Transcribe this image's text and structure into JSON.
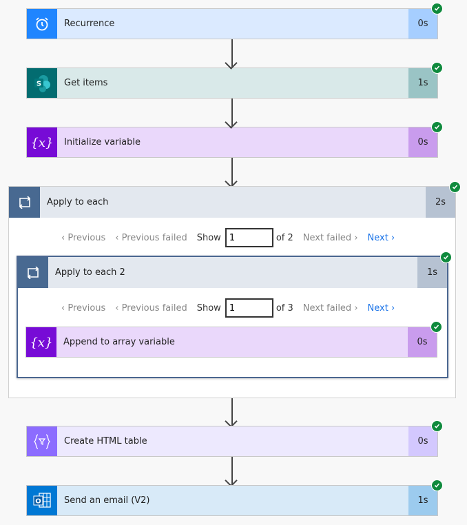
{
  "flow": {
    "top_cards": [
      {
        "name": "recurrence",
        "label": "Recurrence",
        "duration": "0s",
        "icon": "alarm-clock-icon",
        "icon_color": "#1f85ff",
        "body_color": "#dbeaff",
        "dur_color": "#a6ceff",
        "status": "succeeded"
      },
      {
        "name": "get-items",
        "label": "Get items",
        "duration": "1s",
        "icon": "sharepoint-icon",
        "icon_color": "#036c70",
        "body_color": "#d9e9e9",
        "dur_color": "#9ac4c5",
        "status": "succeeded"
      },
      {
        "name": "initialize-variable",
        "label": "Initialize variable",
        "duration": "0s",
        "icon": "variable-icon",
        "icon_color": "#770bd6",
        "body_color": "#ead8fb",
        "dur_color": "#c99ced",
        "status": "succeeded"
      }
    ],
    "apply_to_each": {
      "label": "Apply to each",
      "duration": "2s",
      "icon": "loop-icon",
      "icon_color": "#486991",
      "head_color": "#e3e8ef",
      "dur_color": "#b6c2d2",
      "status": "succeeded",
      "pager": {
        "previous": "Previous",
        "previous_failed": "Previous failed",
        "show": "Show",
        "value": "1",
        "of": "of 2",
        "next_failed": "Next failed",
        "next": "Next"
      },
      "inner": {
        "label": "Apply to each 2",
        "duration": "1s",
        "icon": "loop-icon",
        "status": "succeeded",
        "pager": {
          "previous": "Previous",
          "previous_failed": "Previous failed",
          "show": "Show",
          "value": "1",
          "of": "of 3",
          "next_failed": "Next failed",
          "next": "Next"
        },
        "card": {
          "name": "append-to-array-variable",
          "label": "Append to array variable",
          "duration": "0s",
          "icon": "variable-icon",
          "icon_color": "#770bd6",
          "body_color": "#ead8fb",
          "dur_color": "#c99ced",
          "status": "succeeded"
        }
      }
    },
    "bottom_cards": [
      {
        "name": "create-html-table",
        "label": "Create HTML table",
        "duration": "0s",
        "icon": "data-operation-icon",
        "icon_color": "#8c6cff",
        "body_color": "#ede9fe",
        "dur_color": "#d3c8fe",
        "status": "succeeded"
      },
      {
        "name": "send-an-email",
        "label": "Send an email (V2)",
        "duration": "1s",
        "icon": "outlook-icon",
        "icon_color": "#0078d4",
        "body_color": "#d8eaf8",
        "dur_color": "#9ccbee",
        "status": "succeeded"
      }
    ]
  }
}
